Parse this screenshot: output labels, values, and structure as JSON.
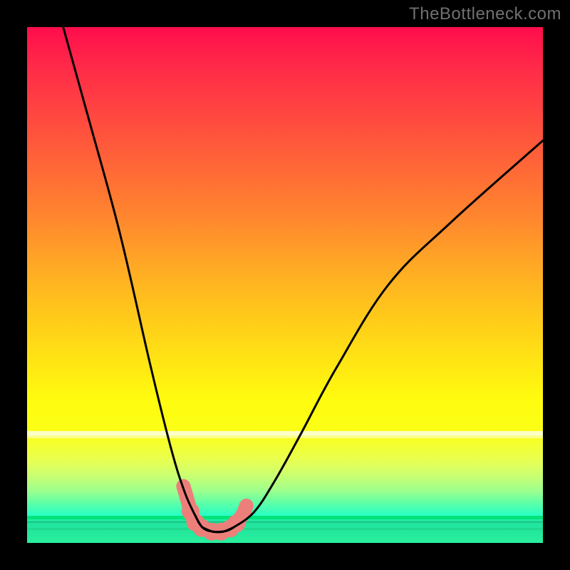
{
  "attribution": "TheBottleneck.com",
  "chart_data": {
    "type": "line",
    "title": "",
    "xlabel": "",
    "ylabel": "",
    "xlim": [
      0,
      100
    ],
    "ylim": [
      0,
      100
    ],
    "grid": false,
    "series": [
      {
        "name": "bottleneck-curve",
        "x": [
          7,
          12,
          18,
          24,
          28,
          30.5,
          32.5,
          34,
          36,
          38,
          40,
          44,
          48,
          53,
          60,
          70,
          82,
          100
        ],
        "values": [
          100,
          82,
          60,
          34,
          18,
          10,
          5.5,
          3,
          2.2,
          2.2,
          3,
          6,
          12,
          21,
          34,
          50,
          62,
          78
        ]
      }
    ],
    "annotations": [
      {
        "type": "marker-cluster",
        "name": "highlight-blobs",
        "points": [
          {
            "x": 30.3,
            "y": 11.0
          },
          {
            "x": 30.9,
            "y": 9.0
          },
          {
            "x": 31.7,
            "y": 6.1
          },
          {
            "x": 32.6,
            "y": 4.0
          },
          {
            "x": 33.9,
            "y": 2.9
          },
          {
            "x": 35.8,
            "y": 2.2
          },
          {
            "x": 37.6,
            "y": 2.2
          },
          {
            "x": 39.4,
            "y": 2.8
          },
          {
            "x": 40.6,
            "y": 3.8
          },
          {
            "x": 41.9,
            "y": 5.7
          },
          {
            "x": 42.5,
            "y": 7.2
          }
        ]
      }
    ],
    "background_gradient": {
      "stops": [
        {
          "pos": 0.0,
          "color": "#ff0d4c"
        },
        {
          "pos": 0.38,
          "color": "#ff8a2d"
        },
        {
          "pos": 0.64,
          "color": "#ffe214"
        },
        {
          "pos": 0.8,
          "color": "#fbff16"
        },
        {
          "pos": 0.92,
          "color": "#57ffaa"
        },
        {
          "pos": 1.0,
          "color": "#29ef9e"
        }
      ]
    }
  },
  "blob_color": "#ed7f7a",
  "curve_color": "#000000"
}
